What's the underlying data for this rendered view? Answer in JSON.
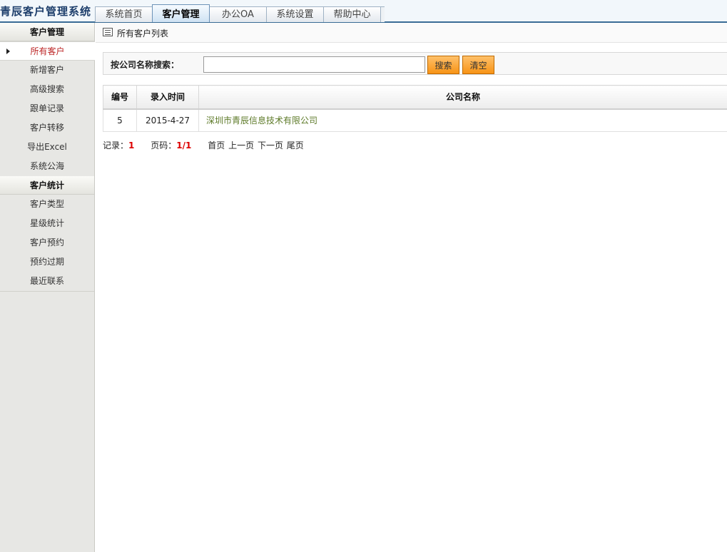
{
  "app": {
    "title": "青辰客户管理系统"
  },
  "tabs": [
    {
      "label": "系统首页"
    },
    {
      "label": "客户管理"
    },
    {
      "label": "办公OA"
    },
    {
      "label": "系统设置"
    },
    {
      "label": "帮助中心"
    }
  ],
  "sidebar": {
    "groups": [
      {
        "title": "客户管理",
        "items": [
          {
            "label": "所有客户"
          },
          {
            "label": "新增客户"
          },
          {
            "label": "高级搜索"
          },
          {
            "label": "跟单记录"
          },
          {
            "label": "客户转移"
          },
          {
            "label": "导出Excel"
          },
          {
            "label": "系统公海"
          }
        ]
      },
      {
        "title": "客户统计",
        "items": [
          {
            "label": "客户类型"
          },
          {
            "label": "星级统计"
          },
          {
            "label": "客户预约"
          },
          {
            "label": "预约过期"
          },
          {
            "label": "最近联系"
          }
        ]
      }
    ]
  },
  "main": {
    "title": "所有客户列表",
    "search": {
      "label": "按公司名称搜索：",
      "value": "",
      "search_button": "搜索",
      "clear_button": "清空"
    },
    "table": {
      "headers": [
        "编号",
        "录入时间",
        "公司名称"
      ],
      "rows": [
        [
          "5",
          "2015-4-27",
          "深圳市青辰信息技术有限公司"
        ]
      ]
    },
    "pager": {
      "records_label": "记录：",
      "records": "1",
      "page_label": "页码：",
      "page": "1/1",
      "first": "首页",
      "prev": "上一页",
      "next": "下一页",
      "last": "尾页"
    }
  }
}
